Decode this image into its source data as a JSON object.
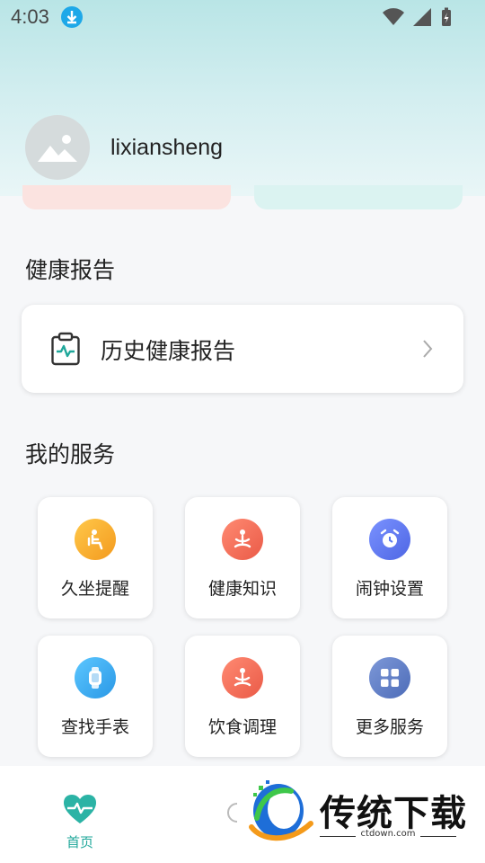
{
  "status_bar": {
    "time": "4:03",
    "icons": [
      "download-icon",
      "wifi-icon",
      "signal-icon",
      "battery-icon"
    ]
  },
  "profile": {
    "username": "lixiansheng",
    "avatar_icon": "image-placeholder-icon"
  },
  "health_report": {
    "section_title": "健康报告",
    "card_label": "历史健康报告",
    "card_icon": "clipboard-heart-icon"
  },
  "services": {
    "section_title": "我的服务",
    "items": [
      {
        "label": "久坐提醒",
        "icon": "sitting-person-icon",
        "color": "#f5a623"
      },
      {
        "label": "健康知识",
        "icon": "meditation-icon",
        "color": "#f06a55"
      },
      {
        "label": "闹钟设置",
        "icon": "alarm-clock-icon",
        "color": "#5b79ee"
      },
      {
        "label": "查找手表",
        "icon": "watch-icon",
        "color": "#3aaef0"
      },
      {
        "label": "饮食调理",
        "icon": "meditation-icon",
        "color": "#f06a55"
      },
      {
        "label": "更多服务",
        "icon": "grid-icon",
        "color": "#5f7fc8"
      }
    ]
  },
  "bottom_nav": {
    "home_label": "首页",
    "home_icon": "heart-pulse-icon",
    "accent": "#1fa79a"
  },
  "watermark": {
    "title": "传统下载",
    "url": "ctdown.com"
  }
}
